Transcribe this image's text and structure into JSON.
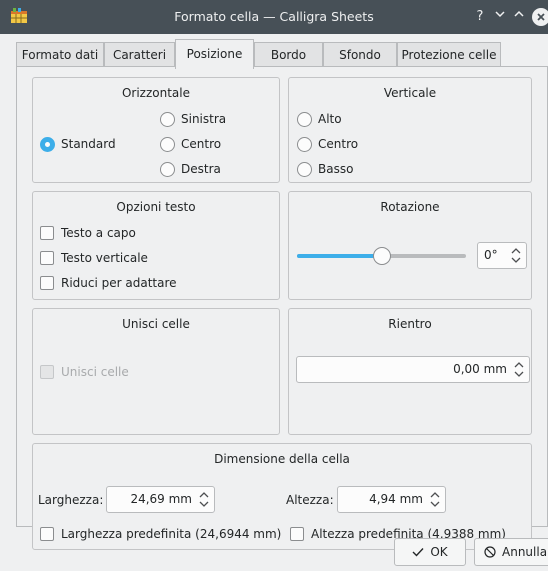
{
  "window": {
    "title": "Formato cella — Calligra Sheets",
    "help_glyph": "?",
    "minimize_glyph": "∨",
    "maximize_glyph": "∧",
    "close_glyph": "×"
  },
  "tabs": [
    {
      "label": "Formato dati",
      "active": false
    },
    {
      "label": "Caratteri",
      "active": false
    },
    {
      "label": "Posizione",
      "active": true
    },
    {
      "label": "Bordo",
      "active": false
    },
    {
      "label": "Sfondo",
      "active": false
    },
    {
      "label": "Protezione celle",
      "active": false
    }
  ],
  "horizontal": {
    "title": "Orizzontale",
    "options": [
      {
        "label": "Standard",
        "checked": true
      },
      {
        "label": "Sinistra",
        "checked": false
      },
      {
        "label": "Centro",
        "checked": false
      },
      {
        "label": "Destra",
        "checked": false
      }
    ]
  },
  "vertical": {
    "title": "Verticale",
    "options": [
      {
        "label": "Alto",
        "checked": false
      },
      {
        "label": "Centro",
        "checked": false
      },
      {
        "label": "Basso",
        "checked": false
      }
    ]
  },
  "text_options": {
    "title": "Opzioni testo",
    "items": [
      {
        "label": "Testo a capo",
        "checked": false
      },
      {
        "label": "Testo verticale",
        "checked": false
      },
      {
        "label": "Riduci per adattare",
        "checked": false
      }
    ]
  },
  "rotation": {
    "title": "Rotazione",
    "value": "0°",
    "slider_level": 0.5
  },
  "merge": {
    "title": "Unisci celle",
    "checkbox_label": "Unisci celle",
    "enabled": false
  },
  "indent": {
    "title": "Rientro",
    "value": "0,00 mm"
  },
  "cell_size": {
    "title": "Dimensione della cella",
    "width_label": "Larghezza:",
    "width_value": "24,69 mm",
    "height_label": "Altezza:",
    "height_value": "4,94 mm",
    "default_width_label": "Larghezza predefinita (24,6944 mm)",
    "default_height_label": "Altezza predefinita (4,9388 mm)"
  },
  "buttons": {
    "ok": "OK",
    "cancel": "Annulla"
  },
  "colors": {
    "accent": "#3daee9",
    "titlebar": "#475057"
  }
}
